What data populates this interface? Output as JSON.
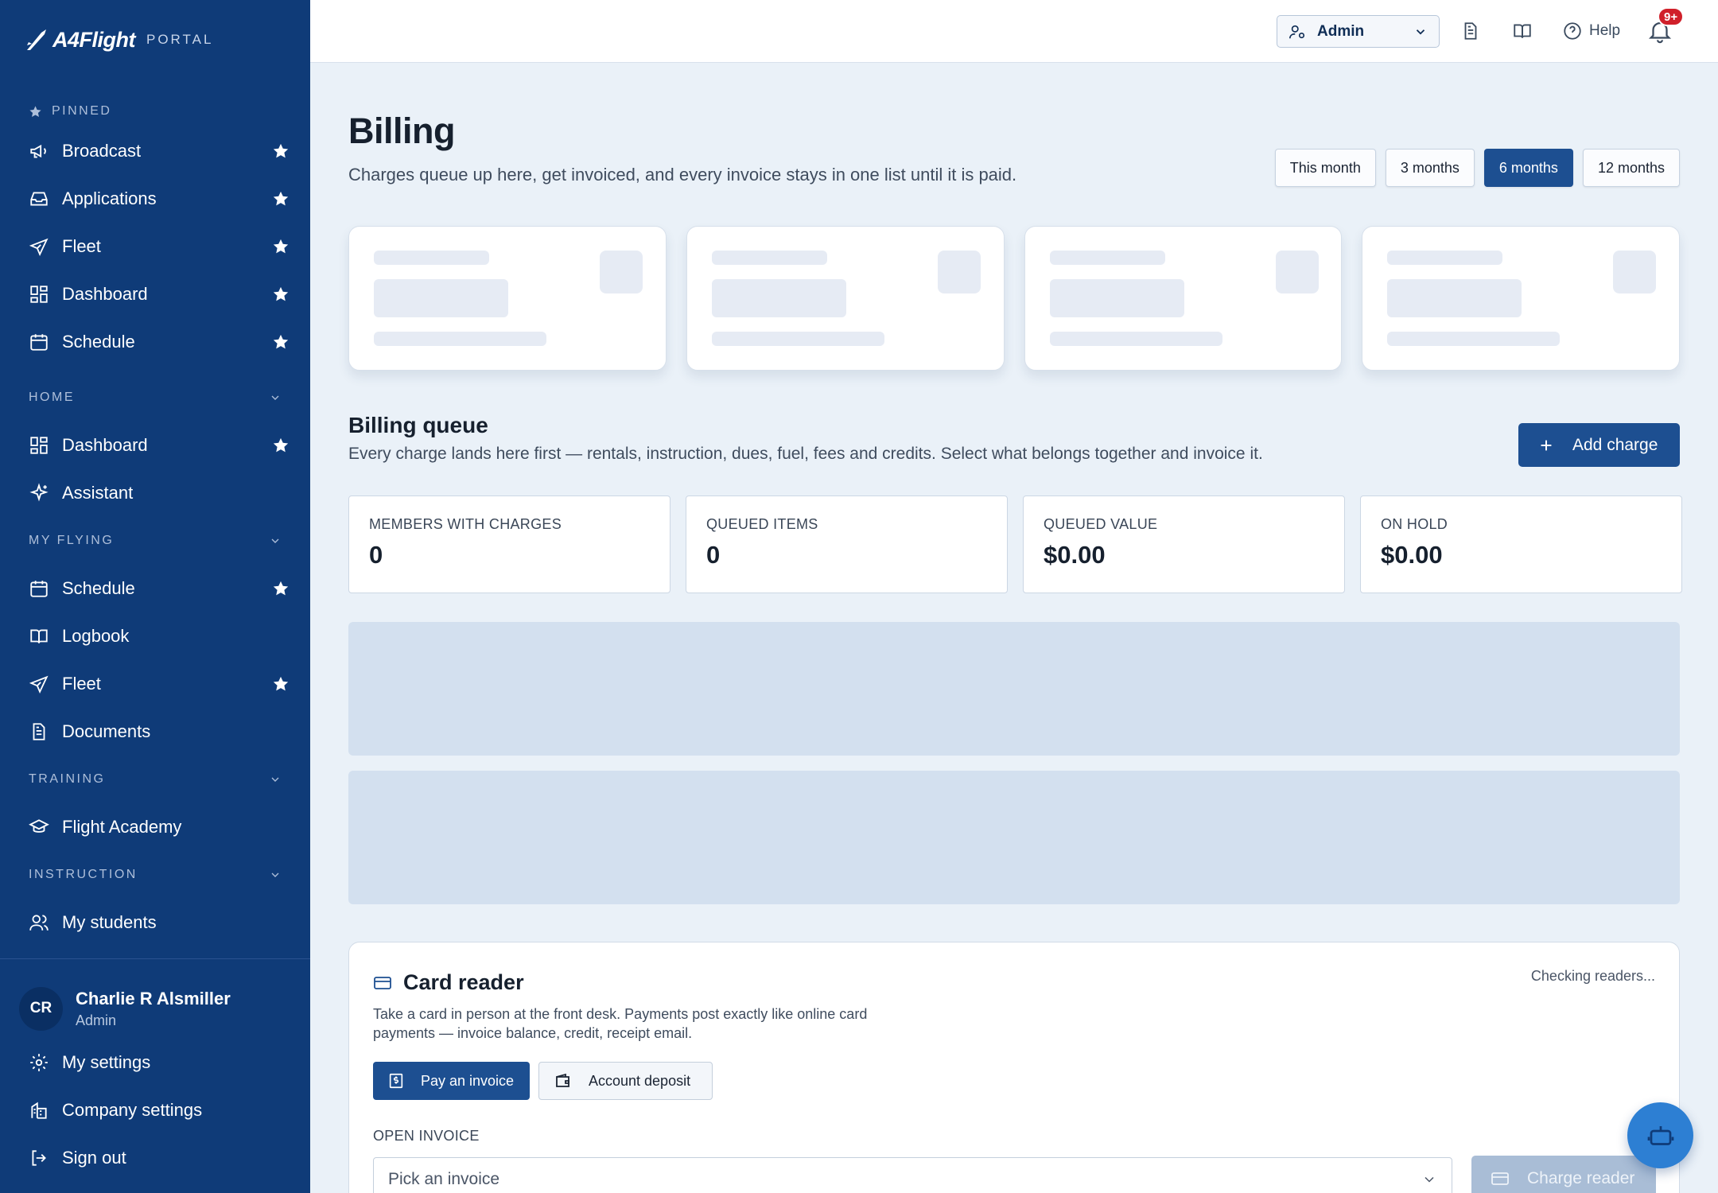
{
  "brand": {
    "name": "A4Flight",
    "portal": "PORTAL"
  },
  "sidebar": {
    "pinned_label": "PINNED",
    "pinned": [
      {
        "label": "Broadcast",
        "icon": "megaphone-icon",
        "starred": true
      },
      {
        "label": "Applications",
        "icon": "inbox-icon",
        "starred": true
      },
      {
        "label": "Fleet",
        "icon": "plane-icon",
        "starred": true
      },
      {
        "label": "Dashboard",
        "icon": "grid-icon",
        "starred": true
      },
      {
        "label": "Schedule",
        "icon": "calendar-icon",
        "starred": true
      }
    ],
    "sections": {
      "home": {
        "label": "HOME",
        "items": [
          {
            "label": "Dashboard",
            "icon": "grid-icon",
            "starred": true
          },
          {
            "label": "Assistant",
            "icon": "sparkle-icon",
            "starred": false
          }
        ]
      },
      "my_flying": {
        "label": "MY FLYING",
        "items": [
          {
            "label": "Schedule",
            "icon": "calendar-icon",
            "starred": true
          },
          {
            "label": "Logbook",
            "icon": "book-icon",
            "starred": false
          },
          {
            "label": "Fleet",
            "icon": "plane-icon",
            "starred": true
          },
          {
            "label": "Documents",
            "icon": "document-icon",
            "starred": false
          }
        ]
      },
      "training": {
        "label": "TRAINING",
        "items": [
          {
            "label": "Flight Academy",
            "icon": "graduation-cap-icon",
            "starred": false
          }
        ]
      },
      "instruction": {
        "label": "INSTRUCTION",
        "items": [
          {
            "label": "My students",
            "icon": "users-icon",
            "starred": false
          }
        ]
      }
    },
    "user": {
      "initials": "CR",
      "name": "Charlie R Alsmiller",
      "role": "Admin"
    },
    "footer": [
      {
        "label": "My settings",
        "icon": "gear-icon"
      },
      {
        "label": "Company settings",
        "icon": "building-icon"
      },
      {
        "label": "Sign out",
        "icon": "sign-out-icon"
      }
    ]
  },
  "topbar": {
    "role_value": "Admin",
    "help_label": "Help",
    "notifications_badge": "9+"
  },
  "page": {
    "title": "Billing",
    "subtitle": "Charges queue up here, get invoiced, and every invoice stays in one list until it is paid.",
    "ranges": [
      "This month",
      "3 months",
      "6 months",
      "12 months"
    ],
    "active_range": "6 months"
  },
  "queue": {
    "title": "Billing queue",
    "subtitle": "Every charge lands here first — rentals, instruction, dues, fuel, fees and credits. Select what belongs together and invoice it.",
    "add_label": "Add charge",
    "stats": [
      {
        "label": "MEMBERS WITH CHARGES",
        "value": "0"
      },
      {
        "label": "QUEUED ITEMS",
        "value": "0"
      },
      {
        "label": "QUEUED VALUE",
        "value": "$0.00"
      },
      {
        "label": "ON HOLD",
        "value": "$0.00"
      }
    ]
  },
  "card_reader": {
    "title": "Card reader",
    "status": "Checking readers...",
    "description": "Take a card in person at the front desk. Payments post exactly like online card payments — invoice balance, credit, receipt email.",
    "pay_invoice_label": "Pay an invoice",
    "account_deposit_label": "Account deposit",
    "open_invoice_label": "OPEN INVOICE",
    "invoice_placeholder": "Pick an invoice",
    "charge_label": "Charge reader"
  },
  "colors": {
    "sidebar_bg": "#0f3b78",
    "primary": "#1d4f91",
    "page_bg": "#eaf1f8",
    "badge": "#d0202a",
    "fab": "#2d7fd3"
  }
}
